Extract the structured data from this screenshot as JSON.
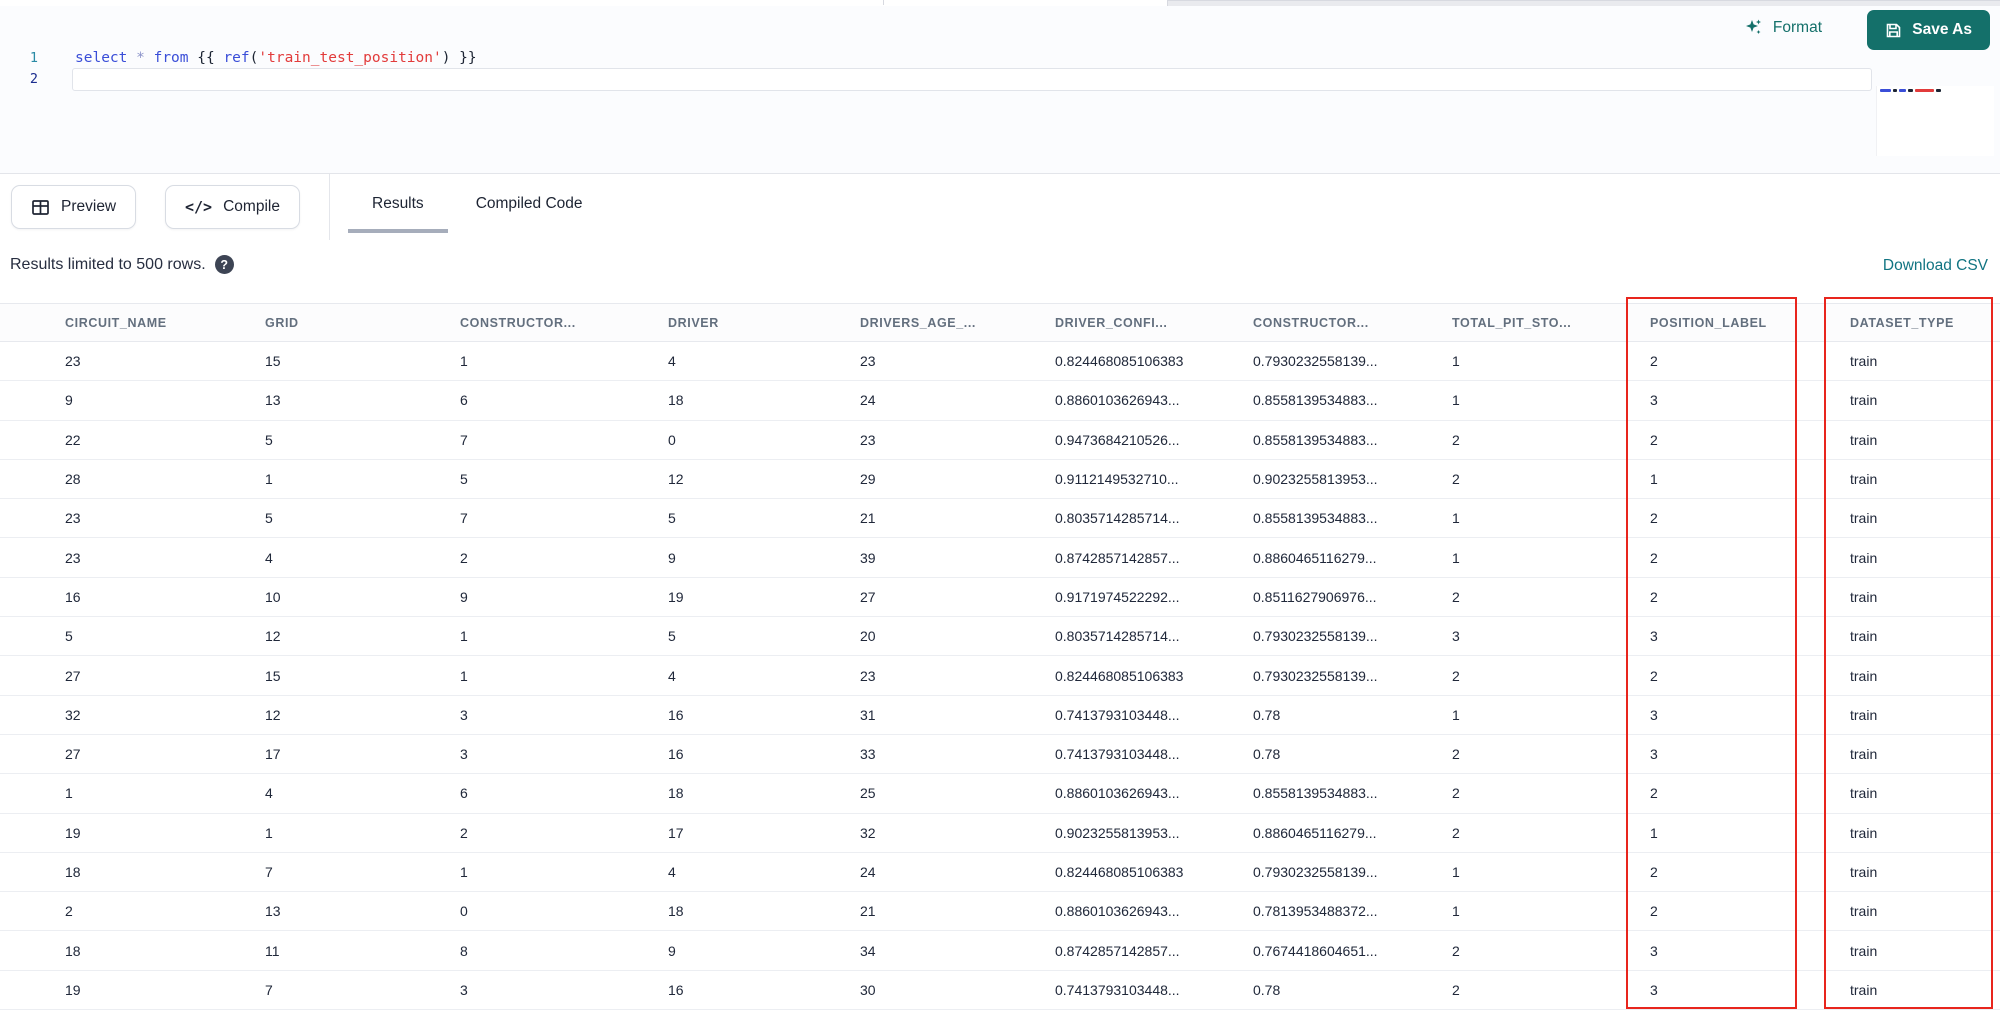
{
  "colors": {
    "accent_teal": "#14706a",
    "link_teal": "#117482",
    "highlight_red": "#e8251d",
    "keyword_blue": "#3a4ed8",
    "string_red": "#e23b3b"
  },
  "editor_toolbar": {
    "format_label": "Format",
    "save_as_label": "Save As"
  },
  "editor": {
    "lines": [
      {
        "number": "1",
        "tokens": [
          {
            "text": "select",
            "type": "keyword"
          },
          {
            "text": " ",
            "type": "plain"
          },
          {
            "text": "*",
            "type": "operator"
          },
          {
            "text": " ",
            "type": "plain"
          },
          {
            "text": "from",
            "type": "keyword"
          },
          {
            "text": " ",
            "type": "plain"
          },
          {
            "text": "{{ ",
            "type": "punct"
          },
          {
            "text": "ref",
            "type": "keyword"
          },
          {
            "text": "(",
            "type": "punct"
          },
          {
            "text": "'train_test_position'",
            "type": "string"
          },
          {
            "text": ")",
            "type": "punct"
          },
          {
            "text": " }}",
            "type": "punct"
          }
        ]
      },
      {
        "number": "2",
        "tokens": []
      }
    ],
    "minimap_segments": [
      {
        "color": "#3a4ed8",
        "w": 11
      },
      {
        "color": "#1c2433",
        "w": 4
      },
      {
        "color": "#3a4ed8",
        "w": 7
      },
      {
        "color": "#1c2433",
        "w": 5
      },
      {
        "color": "#e23b3b",
        "w": 19
      },
      {
        "color": "#1c2433",
        "w": 5
      }
    ]
  },
  "results_toolbar": {
    "preview_label": "Preview",
    "compile_label": "Compile",
    "compile_glyph": "</>",
    "tabs": [
      {
        "label": "Results",
        "active": true
      },
      {
        "label": "Compiled Code",
        "active": false
      }
    ]
  },
  "status_bar": {
    "message": "Results limited to 500 rows.",
    "help_glyph": "?",
    "download_label": "Download CSV"
  },
  "table": {
    "columns": [
      "CIRCUIT_NAME",
      "GRID",
      "CONSTRUCTOR...",
      "DRIVER",
      "DRIVERS_AGE_...",
      "DRIVER_CONFI...",
      "CONSTRUCTOR...",
      "TOTAL_PIT_STO...",
      "POSITION_LABEL",
      "DATASET_TYPE"
    ],
    "highlighted_columns": [
      "POSITION_LABEL",
      "DATASET_TYPE"
    ],
    "rows": [
      [
        "23",
        "15",
        "1",
        "4",
        "23",
        "0.824468085106383",
        "0.7930232558139...",
        "1",
        "2",
        "train"
      ],
      [
        "9",
        "13",
        "6",
        "18",
        "24",
        "0.8860103626943...",
        "0.8558139534883...",
        "1",
        "3",
        "train"
      ],
      [
        "22",
        "5",
        "7",
        "0",
        "23",
        "0.9473684210526...",
        "0.8558139534883...",
        "2",
        "2",
        "train"
      ],
      [
        "28",
        "1",
        "5",
        "12",
        "29",
        "0.9112149532710...",
        "0.9023255813953...",
        "2",
        "1",
        "train"
      ],
      [
        "23",
        "5",
        "7",
        "5",
        "21",
        "0.8035714285714...",
        "0.8558139534883...",
        "1",
        "2",
        "train"
      ],
      [
        "23",
        "4",
        "2",
        "9",
        "39",
        "0.8742857142857...",
        "0.8860465116279...",
        "1",
        "2",
        "train"
      ],
      [
        "16",
        "10",
        "9",
        "19",
        "27",
        "0.9171974522292...",
        "0.8511627906976...",
        "2",
        "2",
        "train"
      ],
      [
        "5",
        "12",
        "1",
        "5",
        "20",
        "0.8035714285714...",
        "0.7930232558139...",
        "3",
        "3",
        "train"
      ],
      [
        "27",
        "15",
        "1",
        "4",
        "23",
        "0.824468085106383",
        "0.7930232558139...",
        "2",
        "2",
        "train"
      ],
      [
        "32",
        "12",
        "3",
        "16",
        "31",
        "0.7413793103448...",
        "0.78",
        "1",
        "3",
        "train"
      ],
      [
        "27",
        "17",
        "3",
        "16",
        "33",
        "0.7413793103448...",
        "0.78",
        "2",
        "3",
        "train"
      ],
      [
        "1",
        "4",
        "6",
        "18",
        "25",
        "0.8860103626943...",
        "0.8558139534883...",
        "2",
        "2",
        "train"
      ],
      [
        "19",
        "1",
        "2",
        "17",
        "32",
        "0.9023255813953...",
        "0.8860465116279...",
        "2",
        "1",
        "train"
      ],
      [
        "18",
        "7",
        "1",
        "4",
        "24",
        "0.824468085106383",
        "0.7930232558139...",
        "1",
        "2",
        "train"
      ],
      [
        "2",
        "13",
        "0",
        "18",
        "21",
        "0.8860103626943...",
        "0.7813953488372...",
        "1",
        "2",
        "train"
      ],
      [
        "18",
        "11",
        "8",
        "9",
        "34",
        "0.8742857142857...",
        "0.7674418604651...",
        "2",
        "3",
        "train"
      ],
      [
        "19",
        "7",
        "3",
        "16",
        "30",
        "0.7413793103448...",
        "0.78",
        "2",
        "3",
        "train"
      ]
    ]
  }
}
